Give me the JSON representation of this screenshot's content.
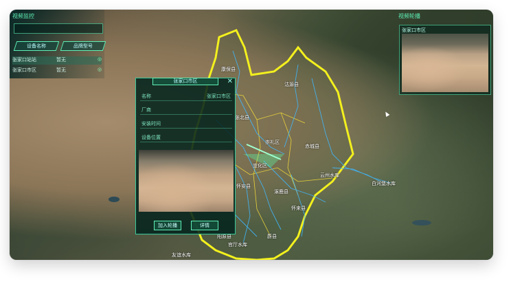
{
  "left_panel": {
    "title": "视频监控",
    "search_placeholder": "",
    "tabs": [
      "设备名称",
      "品牌型号"
    ],
    "rows": [
      {
        "name": "张家口站站",
        "status": "暂无",
        "icon": "eye-icon"
      },
      {
        "name": "张家口市区",
        "status": "暂无",
        "icon": "eye-icon"
      }
    ]
  },
  "right_panel": {
    "title": "视频轮播",
    "video_caption": "张家口市区"
  },
  "popup": {
    "title": "张家口市区",
    "close": "✕",
    "fields": [
      {
        "key": "名称",
        "value": "张家口市区"
      },
      {
        "key": "厂商",
        "value": ""
      },
      {
        "key": "安装时间",
        "value": ""
      },
      {
        "key": "设备位置",
        "value": ""
      }
    ],
    "buttons": [
      "加入轮播",
      "详情"
    ]
  },
  "map_labels": [
    "康保县",
    "沽源县",
    "张北县",
    "崇礼区",
    "赤城县",
    "怀来县",
    "涿鹿县",
    "蔚县",
    "阳原县",
    "云州水库",
    "白河堡水库",
    "友谊水库",
    "官厅水库",
    "宣化区",
    "怀安县"
  ],
  "colors": {
    "accent": "#5ff0b6",
    "boundary": "#f3f01e",
    "river": "#3fb8ff"
  }
}
